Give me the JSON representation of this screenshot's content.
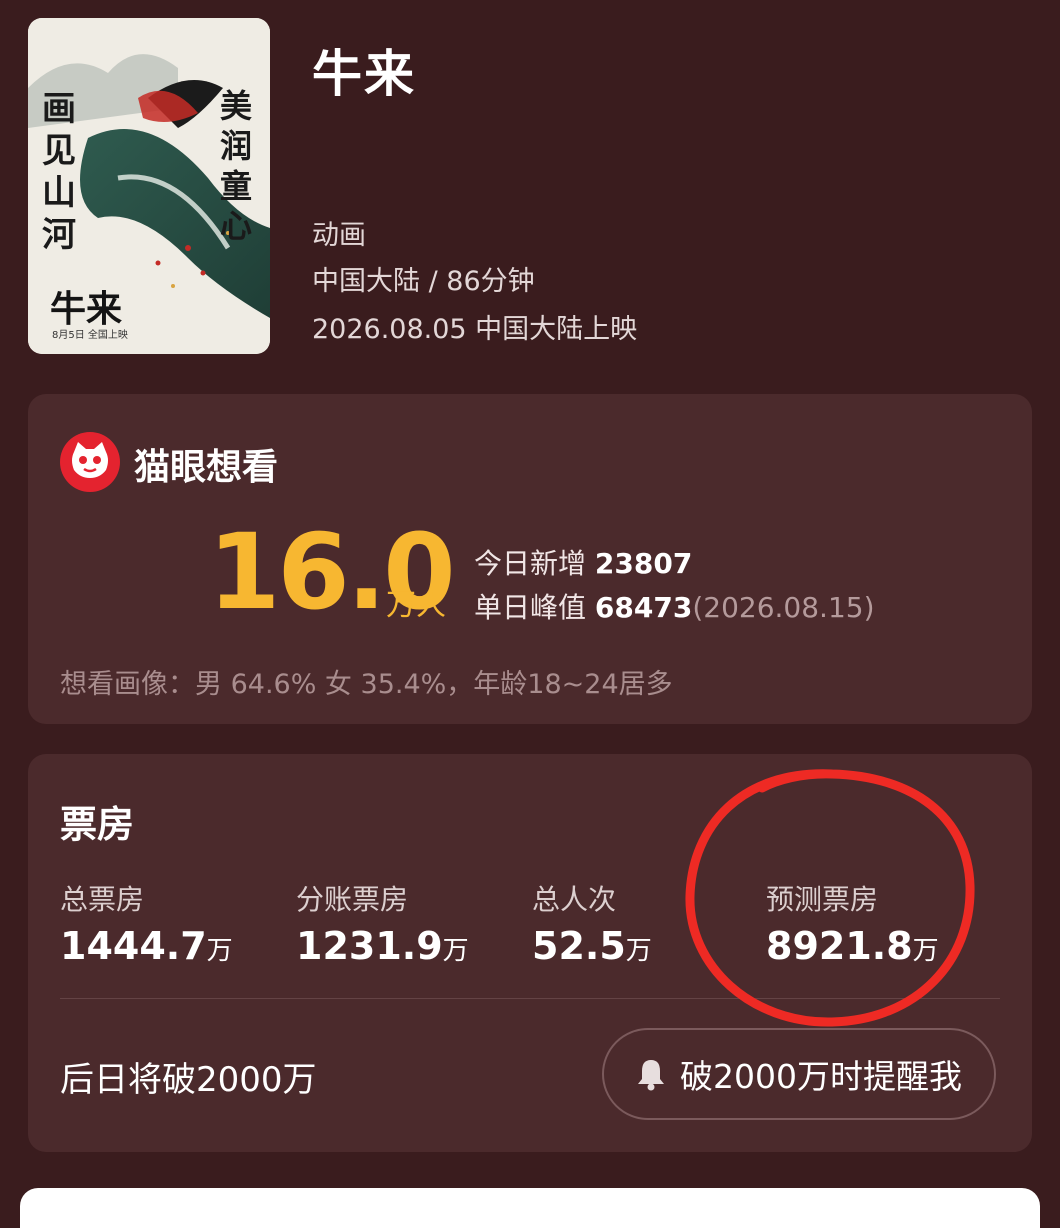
{
  "movie": {
    "title": "牛来",
    "genre": "动画",
    "region_duration": "中国大陆 / 86分钟",
    "release": "2026.08.05 中国大陆上映",
    "poster": {
      "title_calligraphy": "牛来",
      "left_text": "画见山河",
      "right_text": "美润童心",
      "date_line": "8月5日  全国上映"
    }
  },
  "wish": {
    "title": "猫眼想看",
    "count": "16.0",
    "count_unit": "万人",
    "today_label": "今日新增",
    "today_value": "23807",
    "peak_label": "单日峰值",
    "peak_value": "68473",
    "peak_date": "(2026.08.15)",
    "portrait": "想看画像：男 64.6% 女 35.4%，年龄18~24居多"
  },
  "boxoffice": {
    "title": "票房",
    "metrics": [
      {
        "label": "总票房",
        "value": "1444.7",
        "unit": "万"
      },
      {
        "label": "分账票房",
        "value": "1231.9",
        "unit": "万"
      },
      {
        "label": "总人次",
        "value": "52.5",
        "unit": "万"
      },
      {
        "label": "预测票房",
        "value": "8921.8",
        "unit": "万"
      }
    ],
    "forecast_text": "后日将破2000万",
    "remind_label": "破2000万时提醒我"
  },
  "colors": {
    "background": "#3a1c1e",
    "card": "#4b2a2c",
    "accent_gold": "#f7b731",
    "annotation_red": "#ee2a24",
    "maoyan_red": "#e4232f"
  },
  "icons": {
    "maoyan": "maoyan-cat-icon",
    "remind": "bell-icon"
  }
}
